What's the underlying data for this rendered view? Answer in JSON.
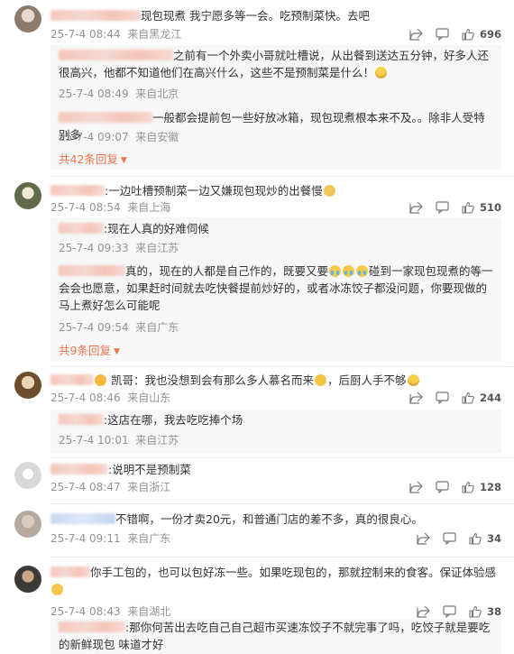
{
  "comments": [
    {
      "text": "现包现煮 我宁愿多等一会。吃预制菜快。去吧",
      "date": "25-7-4 08:44",
      "location": "来自黑龙江",
      "likes": "696",
      "replies": [
        {
          "text": "之前有一个外卖小哥就吐槽说，从出餐到送达五分钟，好多人还很高兴，他都不知道他们在高兴什么，这些不是预制菜是什么！",
          "date": "25-7-4 08:49",
          "location": "来自北京"
        },
        {
          "text": "一般都会提前包一些好放冰箱，现包现煮根本来不及。。除非人受特别多",
          "date": "25-7-4 09:07",
          "location": "来自安徽"
        }
      ],
      "more": "共42条回复"
    },
    {
      "text": ":一边吐槽预制菜一边又嫌现包现炒的出餐慢",
      "date": "25-7-4 08:54",
      "location": "来自上海",
      "likes": "510",
      "replies": [
        {
          "text": ":现在人真的好难伺候",
          "date": "25-7-4 09:33",
          "location": "来自江苏"
        },
        {
          "text": "真的，现在的人都是自己作的，既要又要",
          "text2": "碰到一家现包现煮的等一会会也愿意，如果赶时间就去吃快餐提前炒好的，或者冰冻饺子都没问题，你要现做的马上煮好怎么可能呢",
          "date": "25-7-4 09:54",
          "location": "来自广东"
        }
      ],
      "more": "共9条回复"
    },
    {
      "text_pre": "凯哥：",
      "text": "我也没想到会有那么多人慕名而来",
      "text_post": "，后厨人手不够",
      "date": "25-7-4 08:46",
      "location": "来自山东",
      "likes": "244",
      "replies": [
        {
          "text": ":这店在哪，我去吃吃捧个场",
          "date": "25-7-4 10:01",
          "location": "来自江苏"
        }
      ]
    },
    {
      "text": ":说明不是预制菜",
      "date": "25-7-4 08:47",
      "location": "来自浙江",
      "likes": "128"
    },
    {
      "text": "不错啊，一份才卖20元，和普通门店的差不多，真的很良心。",
      "date": "25-7-4 09:11",
      "location": "来自广东",
      "likes": "34"
    },
    {
      "text": "你手工包的，也可以包好冻一些。如果吃现包的，那就控制来的食客。保证体验感",
      "date": "25-7-4 08:43",
      "location": "来自湖北",
      "likes": "38",
      "replies": [
        {
          "text": ":那你何苦出去吃自己自己超市买速冻饺子不就完事了吗，吃饺子就是要吃的新鲜现包 味道才好"
        }
      ]
    }
  ],
  "icons": {
    "share": "share-icon",
    "reply": "comment-icon",
    "like": "thumbs-up-icon"
  },
  "colors": {
    "accent": "#eb7350",
    "meta": "#939393",
    "reply_bg": "#f7f7f7"
  }
}
